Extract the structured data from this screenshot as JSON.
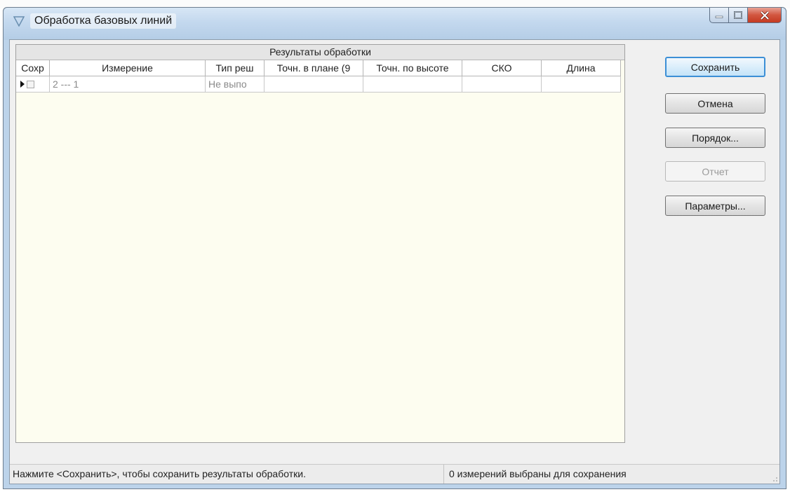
{
  "window": {
    "title": "Обработка базовых линий"
  },
  "grid": {
    "caption": "Результаты обработки",
    "columns": [
      "Сохр",
      "Измерение",
      "Тип реш",
      "Точн. в плане (9",
      "Точн. по высоте",
      "СКО",
      "Длина"
    ],
    "rows": [
      {
        "save": "",
        "measurement": "2 --- 1",
        "solution_type": "Не выпо",
        "horiz_precision": "",
        "vert_precision": "",
        "rms": "",
        "length": ""
      }
    ]
  },
  "buttons": {
    "save": "Сохранить",
    "cancel": "Отмена",
    "order": "Порядок...",
    "report": "Отчет",
    "parameters": "Параметры..."
  },
  "status": {
    "hint": "Нажмите <Сохранить>, чтобы сохранить результаты обработки.",
    "count": "0 измерений выбраны для сохранения"
  }
}
